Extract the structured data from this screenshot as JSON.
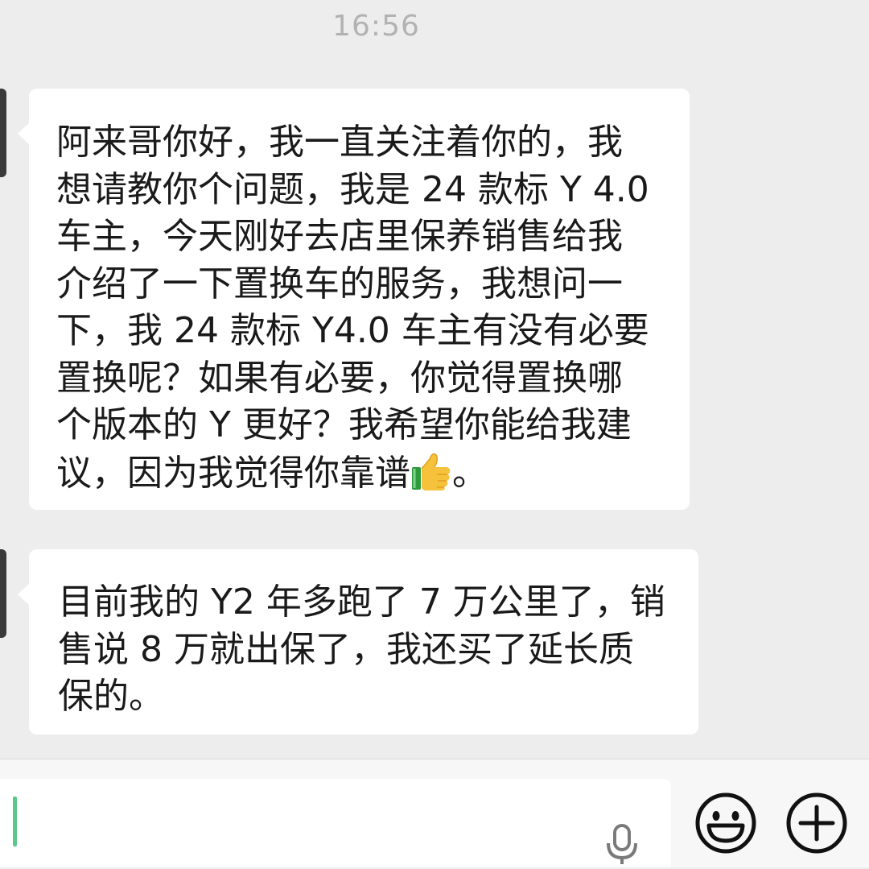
{
  "chat": {
    "timestamp": "16:56",
    "messages": [
      {
        "lines": [
          "阿来哥你好，我一直关注着你的，我",
          "想请教你个问题，我是 24 款标 Y 4.0",
          "车主，今天刚好去店里保养销售给我",
          "介绍了一下置换车的服务，我想问一",
          "下，我 24 款标 Y4.0 车主有没有必要",
          "置换呢？如果有必要，你觉得置换哪",
          "个版本的 Y 更好？我希望你能给我建"
        ],
        "last_line_before_emoji": "议，因为我觉得你靠谱",
        "emoji": "thumbs-up",
        "last_line_after_emoji": "。"
      },
      {
        "lines": [
          "目前我的 Y2 年多跑了 7 万公里了，销",
          "售说 8 万就出保了，我还买了延长质",
          "保的。"
        ]
      }
    ]
  },
  "input_bar": {
    "text_value": "",
    "icons": [
      "microphone-icon",
      "emoji-icon",
      "plus-icon"
    ]
  },
  "colors": {
    "background": "#ededed",
    "bubble": "#ffffff",
    "caret": "#5ac88a",
    "timestamp": "#b2b2b2"
  }
}
